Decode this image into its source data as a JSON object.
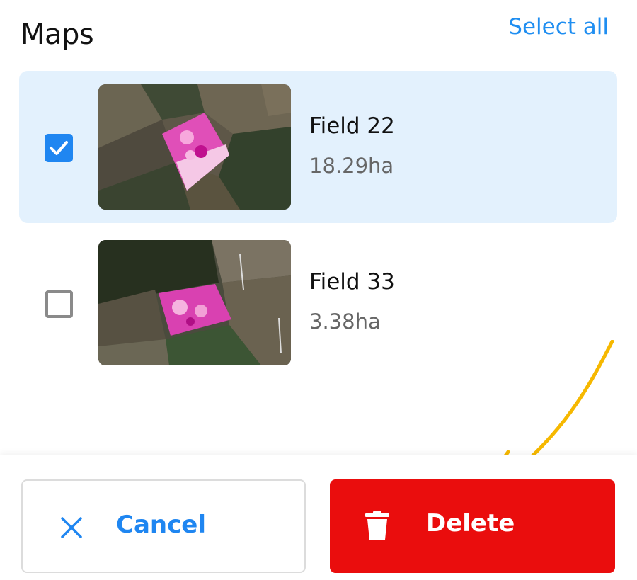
{
  "header": {
    "title": "Maps",
    "select_all_label": "Select all"
  },
  "fields": [
    {
      "name": "Field 22",
      "area": "18.29ha",
      "checked": true
    },
    {
      "name": "Field 33",
      "area": "3.38ha",
      "checked": false
    }
  ],
  "footer": {
    "cancel_label": "Cancel",
    "delete_label": "Delete"
  },
  "icons": {
    "cancel": "close-icon",
    "delete": "trash-icon",
    "check": "checkmark-icon"
  },
  "colors": {
    "accent": "#1f86f1",
    "danger": "#ea0d0d",
    "selected_row": "#e3f1fd",
    "annotation": "#f6b800"
  }
}
